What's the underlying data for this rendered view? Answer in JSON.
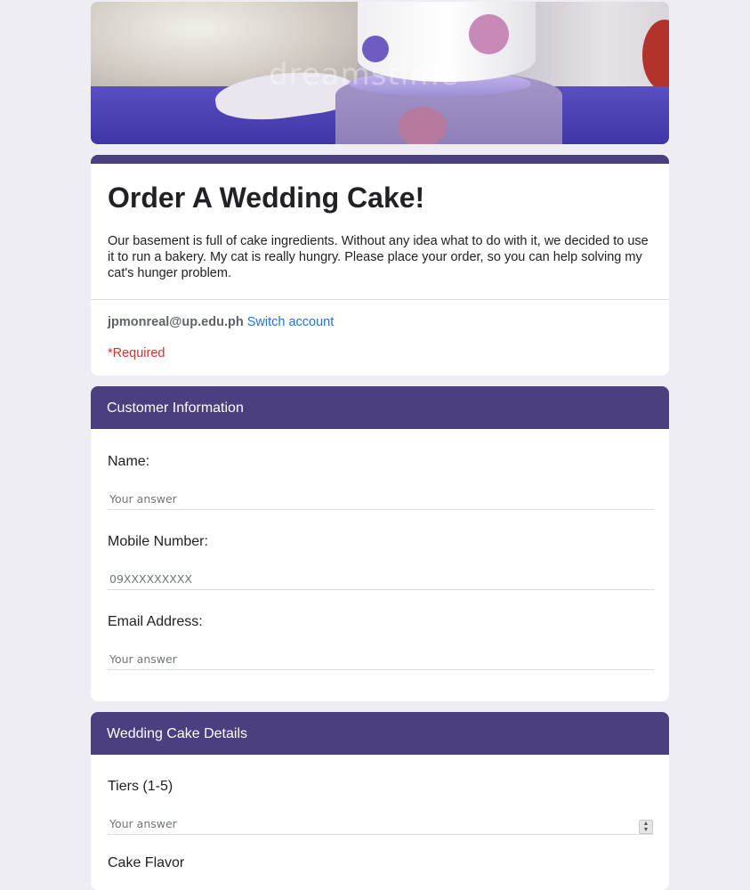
{
  "form": {
    "title": "Order A Wedding Cake!",
    "description": "Our basement is full of cake ingredients. Without any idea what to do with it, we decided to use it to run a bakery. My cat is really hungry. Please place your order, so you can help solving my cat's hunger problem.",
    "account_email": "jpmonreal@up.edu.ph",
    "switch_account_label": "Switch account",
    "required_note": "*Required",
    "accent_color": "#4b3f80"
  },
  "banner": {
    "watermark": "dreamstime"
  },
  "sections": [
    {
      "title": "Customer Information",
      "questions": [
        {
          "label": "Name:",
          "placeholder": "Your answer"
        },
        {
          "label": "Mobile Number:",
          "placeholder": "09XXXXXXXXX"
        },
        {
          "label": "Email Address:",
          "placeholder": "Your answer"
        }
      ]
    },
    {
      "title": "Wedding Cake Details",
      "questions": [
        {
          "label": "Tiers (1-5)",
          "placeholder": "Your answer"
        },
        {
          "label": "Cake Flavor"
        }
      ]
    }
  ]
}
